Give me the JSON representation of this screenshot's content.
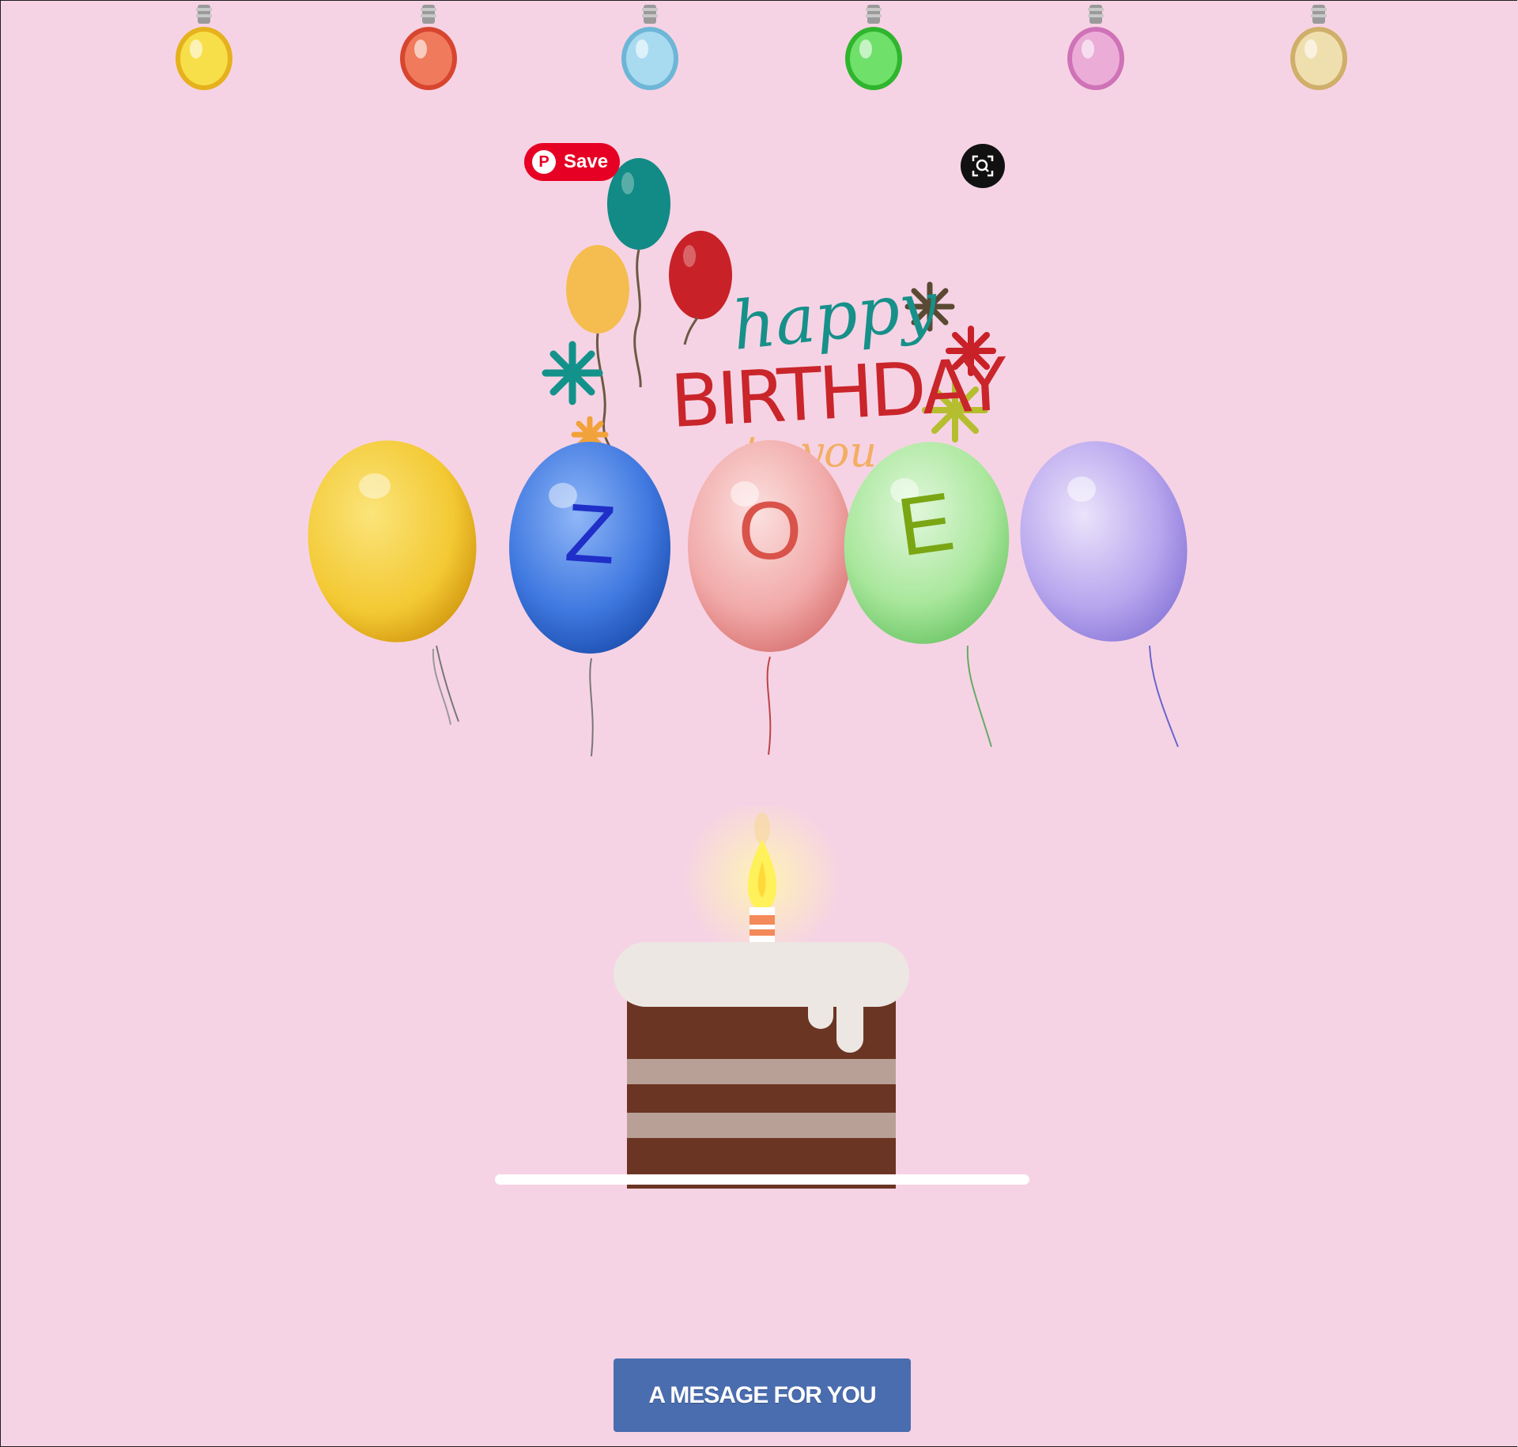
{
  "bulbs": [
    {
      "name": "yellow",
      "glass": "#f7df4a",
      "shade": "#e5b11c"
    },
    {
      "name": "red",
      "glass": "#f07a5c",
      "shade": "#d8452f"
    },
    {
      "name": "blue",
      "glass": "#a9dbf0",
      "shade": "#6db6d7"
    },
    {
      "name": "green",
      "glass": "#6fe06a",
      "shade": "#2fb52e"
    },
    {
      "name": "pink",
      "glass": "#ecacd8",
      "shade": "#cf72b7"
    },
    {
      "name": "gold",
      "glass": "#f0dfae",
      "shade": "#cfaf6a"
    }
  ],
  "pinterest": {
    "save_label": "Save",
    "icon": "pinterest-icon"
  },
  "lens": {
    "icon": "visual-search-icon"
  },
  "greeting": {
    "line1": "happy",
    "line2": "BIRTHDAY",
    "line3": "to you",
    "colors": {
      "happy": "#17908a",
      "birthday": "#c9252a",
      "to_you": "#f2a23a"
    }
  },
  "name_balloons": [
    {
      "letter": "",
      "color": "#f3c933",
      "dark": "#d49a12",
      "letter_color": "#1f2fc7"
    },
    {
      "letter": "Z",
      "color": "#3f78e0",
      "dark": "#1d4fb0",
      "letter_color": "#1f2fc7"
    },
    {
      "letter": "O",
      "color": "#f1aaa9",
      "dark": "#d97574",
      "letter_color": "#d9534a"
    },
    {
      "letter": "E",
      "color": "#a9e79c",
      "dark": "#6fc769",
      "letter_color": "#7aa613"
    },
    {
      "letter": "",
      "color": "#b8a6ee",
      "dark": "#8b7ad9",
      "letter_color": "#5a4fc0"
    }
  ],
  "message_button": {
    "label": "A MESAGE FOR YOU",
    "color": "#4a6db0"
  }
}
